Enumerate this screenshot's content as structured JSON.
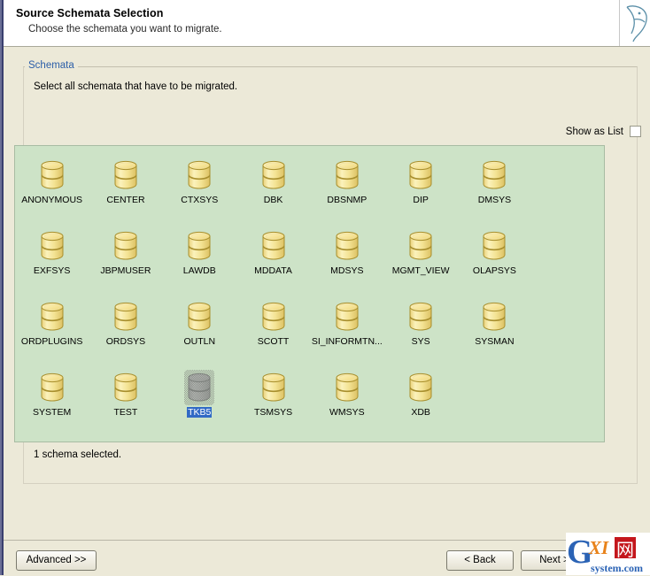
{
  "window": {
    "title": "Source Schemata Selection",
    "subtitle": "Choose the schemata you want to migrate.",
    "logo_icon": "mysql-dolphin-icon"
  },
  "groupbox": {
    "legend": "Schemata",
    "instruction": "Select all schemata that have to be migrated."
  },
  "search": {
    "icon": "search-icon",
    "value": "",
    "placeholder": ""
  },
  "show_as_list": {
    "label": "Show as List",
    "checked": false
  },
  "schemata": {
    "icon_type": "database-cylinder-icon",
    "items": [
      {
        "label": "ANONYMOUS",
        "selected": false
      },
      {
        "label": "CENTER",
        "selected": false
      },
      {
        "label": "CTXSYS",
        "selected": false
      },
      {
        "label": "DBK",
        "selected": false
      },
      {
        "label": "DBSNMP",
        "selected": false
      },
      {
        "label": "DIP",
        "selected": false
      },
      {
        "label": "DMSYS",
        "selected": false
      },
      {
        "label": "EXFSYS",
        "selected": false
      },
      {
        "label": "JBPMUSER",
        "selected": false
      },
      {
        "label": "LAWDB",
        "selected": false
      },
      {
        "label": "MDDATA",
        "selected": false
      },
      {
        "label": "MDSYS",
        "selected": false
      },
      {
        "label": "MGMT_VIEW",
        "selected": false
      },
      {
        "label": "OLAPSYS",
        "selected": false
      },
      {
        "label": "ORDPLUGINS",
        "selected": false
      },
      {
        "label": "ORDSYS",
        "selected": false
      },
      {
        "label": "OUTLN",
        "selected": false
      },
      {
        "label": "SCOTT",
        "selected": false
      },
      {
        "label": "SI_INFORMTN...",
        "selected": false
      },
      {
        "label": "SYS",
        "selected": false
      },
      {
        "label": "SYSMAN",
        "selected": false
      },
      {
        "label": "SYSTEM",
        "selected": false
      },
      {
        "label": "TEST",
        "selected": false
      },
      {
        "label": "TKB5",
        "selected": true
      },
      {
        "label": "TSMSYS",
        "selected": false
      },
      {
        "label": "WMSYS",
        "selected": false
      },
      {
        "label": "XDB",
        "selected": false
      }
    ]
  },
  "status": {
    "text": "1 schema selected."
  },
  "footer": {
    "advanced_label": "Advanced >>",
    "back_label": "< Back",
    "next_label": "Next >"
  },
  "watermark": {
    "main": "G",
    "mid": "XI",
    "cjk": "网",
    "domain": "system.com"
  },
  "colors": {
    "dialog_bg": "#ece9d8",
    "panel_green": "#cde3c7",
    "legend_blue": "#2b5ea8",
    "selection_blue": "#316ac5",
    "db_icon_gold": "#f5e08a"
  }
}
